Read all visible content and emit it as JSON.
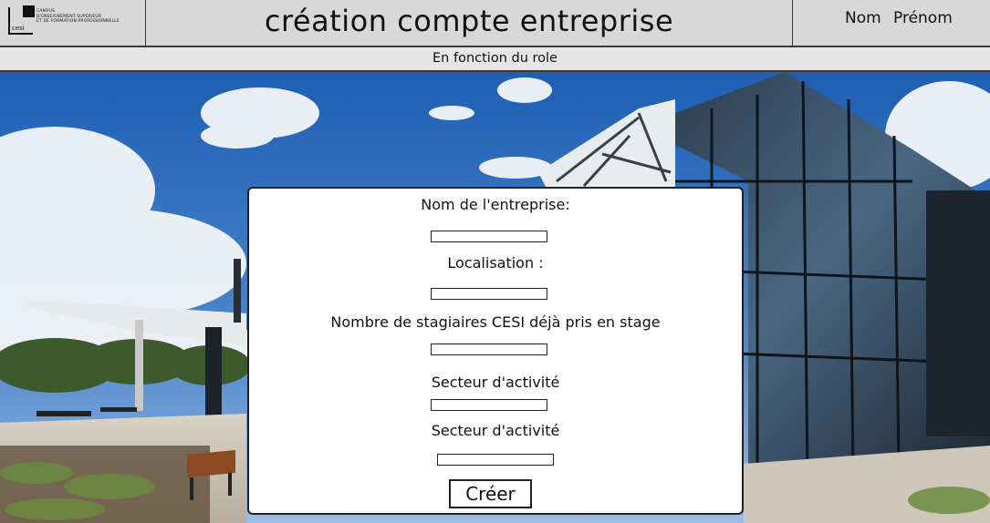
{
  "header": {
    "logo": {
      "brand": "cesi",
      "lines": [
        "CAMPUS",
        "D'ENSEIGNEMENT SUPÉRIEUR",
        "ET DE FORMATION PROFESSIONNELLE"
      ]
    },
    "title": "création compte entreprise",
    "user": {
      "nom": "Nom",
      "prenom": "Prénom"
    }
  },
  "subheader": {
    "text": "En fonction du role"
  },
  "form": {
    "fields": [
      {
        "label": "Nom de l'entreprise:",
        "value": ""
      },
      {
        "label": "Localisation :",
        "value": ""
      },
      {
        "label": "Nombre de stagiaires CESI déjà pris en stage",
        "value": ""
      },
      {
        "label": "Secteur d'activité",
        "value": ""
      },
      {
        "label": "Secteur d'activité",
        "value": ""
      }
    ],
    "submit_label": "Créer"
  },
  "colors": {
    "header_bg": "#d8d8d8",
    "subheader_bg": "#e6e6e6",
    "border": "#3a3a3a",
    "card_bg": "#ffffff"
  }
}
